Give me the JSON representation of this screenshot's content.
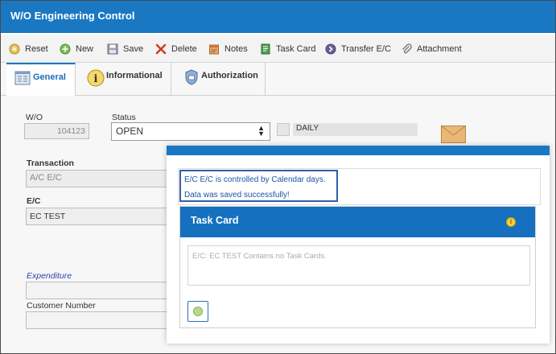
{
  "window": {
    "title": "W/O Engineering Control"
  },
  "toolbar": {
    "items": [
      {
        "label": "Reset",
        "icon": "reset-icon"
      },
      {
        "label": "New",
        "icon": "new-icon"
      },
      {
        "label": "Save",
        "icon": "save-icon"
      },
      {
        "label": "Delete",
        "icon": "delete-icon"
      },
      {
        "label": "Notes",
        "icon": "notes-icon"
      },
      {
        "label": "Task Card",
        "icon": "task-card-icon"
      },
      {
        "label": "Transfer E/C",
        "icon": "transfer-icon"
      },
      {
        "label": "Attachment",
        "icon": "attachment-icon"
      }
    ]
  },
  "tabs": [
    {
      "label": "General",
      "icon": "general-icon",
      "active": true
    },
    {
      "label": "Informational",
      "icon": "info-icon",
      "active": false
    },
    {
      "label": "Authorization",
      "icon": "shield-icon",
      "active": false
    }
  ],
  "form": {
    "wo_label": "W/O",
    "wo_value": "104123",
    "status_label": "Status",
    "status_value": "OPEN",
    "daily_value": "DAILY",
    "transaction_label": "Transaction",
    "transaction_value": "A/C E/C",
    "ec_label": "E/C",
    "ec_value": "EC TEST",
    "expenditure_label": "Expenditure",
    "expenditure_value": "",
    "customer_number_label": "Customer Number",
    "customer_number_value": ""
  },
  "dialog": {
    "messages": [
      "E/C E/C is controlled by Calendar days.",
      "Data was saved successfully!"
    ],
    "task_card": {
      "title": "Task Card",
      "empty_text": "E/C: EC TEST Contains no Task Cards."
    }
  }
}
